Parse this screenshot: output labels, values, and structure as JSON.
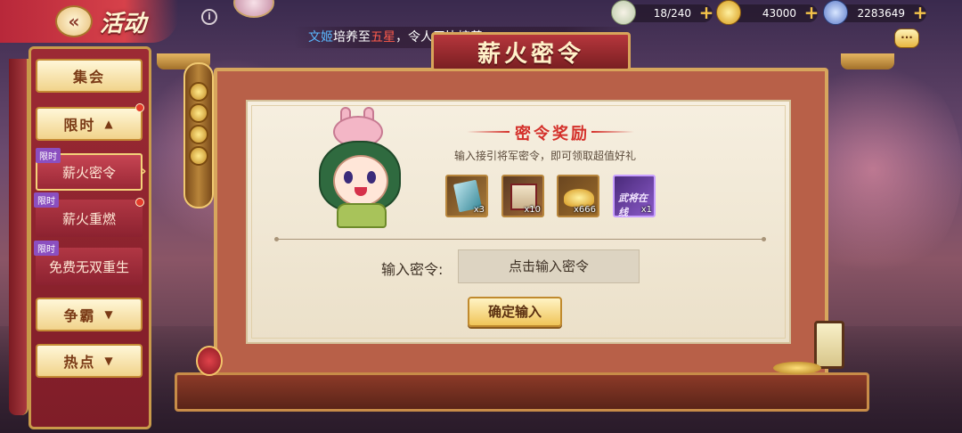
{
  "header": {
    "title": "活动",
    "back_icon": "back-arrow-icon"
  },
  "resources": [
    {
      "name": "stamina",
      "value": "18/240",
      "icon": "bun-icon"
    },
    {
      "name": "gold",
      "value": "43000",
      "icon": "gold-ingot-icon"
    },
    {
      "name": "silver",
      "value": "2283649",
      "icon": "coin-icon"
    }
  ],
  "marquee": {
    "part1": "文姬",
    "part2": "培养至",
    "part3": "五星",
    "part4": "，令人无比惊羡"
  },
  "menu": {
    "collapse": "集会",
    "limited": "限时",
    "sub_items": [
      {
        "tag": "限时",
        "label": "薪火密令"
      },
      {
        "tag": "限时",
        "label": "薪火重燃"
      },
      {
        "tag": "限时",
        "label": "免费无双重生"
      }
    ],
    "compete": "争霸",
    "hot": "热点"
  },
  "panel": {
    "banner_title": "薪火密令",
    "reward_title": "密令奖励",
    "reward_subtitle": "输入接引将军密令，即可领取超值好礼",
    "items": [
      {
        "icon": "scroll-card-icon",
        "count": "x3"
      },
      {
        "icon": "portrait-scroll-icon",
        "count": "x10"
      },
      {
        "icon": "gold-ingot-icon",
        "count": "x666"
      },
      {
        "icon": "title-badge-icon",
        "count": "x1",
        "label": "武将在线"
      }
    ],
    "code_label": "输入密令:",
    "code_placeholder": "点击输入密令",
    "confirm_label": "确定输入"
  },
  "colors": {
    "accent_red": "#d4302a",
    "gold": "#f0c559",
    "menu_red": "#9c2a34"
  }
}
